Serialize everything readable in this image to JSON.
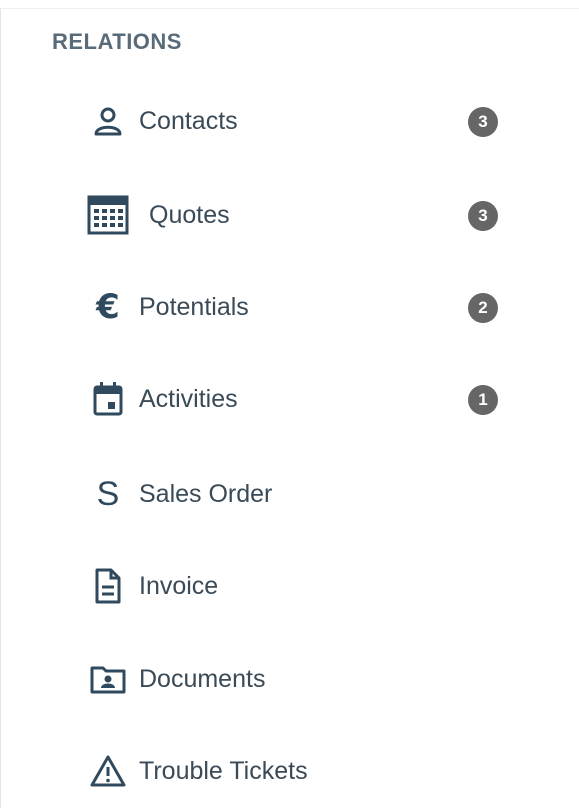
{
  "relations": {
    "title": "RELATIONS",
    "items": [
      {
        "label": "Contacts",
        "icon": "person-icon",
        "badge": "3"
      },
      {
        "label": "Quotes",
        "icon": "calculator-icon",
        "badge": "3"
      },
      {
        "label": "Potentials",
        "icon": "euro-icon",
        "badge": "2"
      },
      {
        "label": "Activities",
        "icon": "calendar-icon",
        "badge": "1"
      },
      {
        "label": "Sales Order",
        "icon": "sales-order-s-icon"
      },
      {
        "label": "Invoice",
        "icon": "document-icon"
      },
      {
        "label": "Documents",
        "icon": "folder-icon"
      },
      {
        "label": "Trouble Tickets",
        "icon": "warning-triangle-icon"
      }
    ]
  },
  "colors": {
    "icon": "#2f4a5e",
    "label": "#3a4a57",
    "title": "#596b78",
    "badge_bg": "#666666",
    "badge_text": "#ffffff"
  }
}
